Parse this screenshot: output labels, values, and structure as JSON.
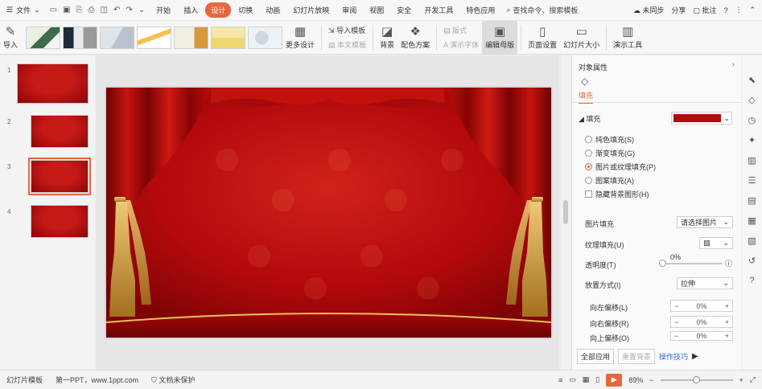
{
  "menubar": {
    "file_label": "文件",
    "tabs": [
      "开始",
      "插入",
      "设计",
      "切换",
      "动画",
      "幻灯片放映",
      "审阅",
      "视图",
      "安全",
      "开发工具",
      "特色应用"
    ],
    "active_tab": "设计",
    "search_label": "查找命令、搜索模板",
    "sync_label": "未同步",
    "share_label": "分享",
    "comment_label": "批注"
  },
  "ribbon": {
    "import_label": "导入",
    "more_design_label": "更多设计",
    "import_template_label": "导入模板",
    "this_template_label": "本文模板",
    "background_label": "背景",
    "color_scheme_label": "配色方案",
    "format_label": "版式",
    "fonts_label": "演示字体",
    "edit_master_label": "编辑母版",
    "page_setup_label": "页面设置",
    "slide_size_label": "幻灯片大小",
    "presentation_tools_label": "演示工具"
  },
  "slides_panel": {
    "slide_numbers": [
      "1",
      "2",
      "3",
      "4"
    ],
    "selected_index": 3
  },
  "properties_panel": {
    "title": "对象属性",
    "tab_label": "填充",
    "fill_header": "填充",
    "options": [
      {
        "label": "纯色填充(S)",
        "checked": false
      },
      {
        "label": "渐变填充(G)",
        "checked": false
      },
      {
        "label": "图片或纹理填充(P)",
        "checked": true
      },
      {
        "label": "图案填充(A)",
        "checked": false
      }
    ],
    "hide_bg_label": "隐藏背景图形(H)",
    "picture_fill_label": "图片填充",
    "picture_fill_value": "请选择图片",
    "texture_fill_label": "纹理填充(U)",
    "transparency_label": "透明度(T)",
    "transparency_value": "0%",
    "placement_label": "放置方式(I)",
    "placement_value": "拉伸",
    "offsets": [
      {
        "label": "向左偏移(L)",
        "value": "0%"
      },
      {
        "label": "向右偏移(R)",
        "value": "0%"
      },
      {
        "label": "向上偏移(O)",
        "value": "0%"
      }
    ],
    "apply_all_label": "全部应用",
    "reset_bg_label": "重置背景",
    "tutorial_label": "操作技巧"
  },
  "statusbar": {
    "slide_label": "幻灯片模板",
    "site_label": "第一PPT，www.1ppt.com",
    "doc_status": "文档未保护",
    "zoom_value": "89%"
  },
  "colors": {
    "accent": "#e8663d",
    "curtain": "#b3090c"
  }
}
